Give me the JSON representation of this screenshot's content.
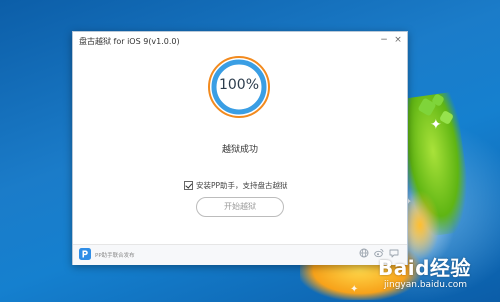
{
  "window": {
    "title": "盘古越狱 for iOS 9(v1.0.0)",
    "minimize_glyph": "−",
    "close_glyph": "×"
  },
  "progress": {
    "value": 1.0,
    "label": "100%",
    "ring_color": "#3a9ee4",
    "accent_color": "#f28a1e"
  },
  "status": {
    "text": "越狱成功"
  },
  "install_option": {
    "checked": true,
    "label": "安装PP助手，支持盘古越狱"
  },
  "start_button": {
    "label": "开始越狱"
  },
  "footer": {
    "logo_icon": "pp-logo-icon",
    "text": "PP助手联合发布",
    "icons": [
      "globe-icon",
      "weibo-icon",
      "chat-bubble-icon"
    ]
  },
  "watermark": {
    "logo": "Baid经验",
    "url": "jingyan.baidu.com"
  }
}
